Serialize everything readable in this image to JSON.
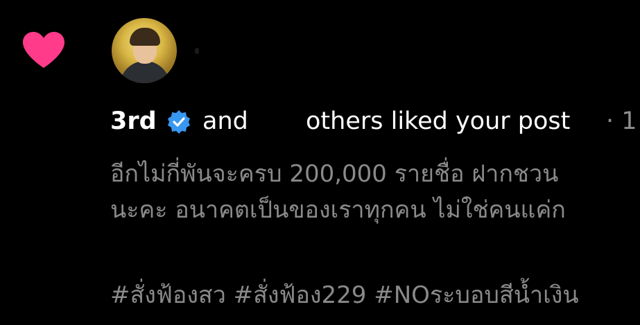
{
  "notification": {
    "type_icon": "heart-icon",
    "heart_color": "#ff3b8a",
    "avatar_icon": "avatar",
    "username": "3rd",
    "verified_icon": "verified-badge-icon",
    "verified_color": "#3897f0",
    "and_text": "and",
    "others_text": "others liked your post",
    "time_text": "· 1"
  },
  "post": {
    "caption_lines": [
      "อีกไม่กี่พันจะครบ 200,000 รายชื่อ ฝากชวน",
      "นะคะ อนาคตเป็นของเราทุกคน ไม่ใช่คนแค่ก"
    ],
    "hashtags": "#สั่งฟ้องสว #สั่งฟ้อง229 #NOระบอบสีน้ำเงิน"
  }
}
